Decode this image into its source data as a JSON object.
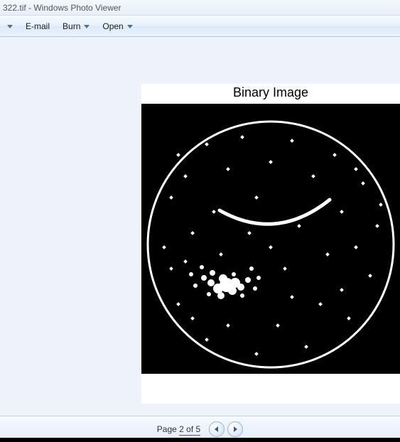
{
  "window": {
    "title": "322.tif - Windows Photo Viewer"
  },
  "toolbar": {
    "items": [
      {
        "label": "",
        "has_dropdown": true
      },
      {
        "label": "E-mail",
        "has_dropdown": false
      },
      {
        "label": "Burn",
        "has_dropdown": true
      },
      {
        "label": "Open",
        "has_dropdown": true
      }
    ]
  },
  "image": {
    "title": "Binary Image"
  },
  "footer": {
    "page_label_prefix": "Page ",
    "page_current": "2",
    "page_of": " of ",
    "page_total": "5",
    "prev_icon": "triangle-left-icon",
    "next_icon": "triangle-right-icon"
  },
  "colors": {
    "viewer_bg": "#eef3fb",
    "toolbar_border": "#b9c9dc"
  }
}
